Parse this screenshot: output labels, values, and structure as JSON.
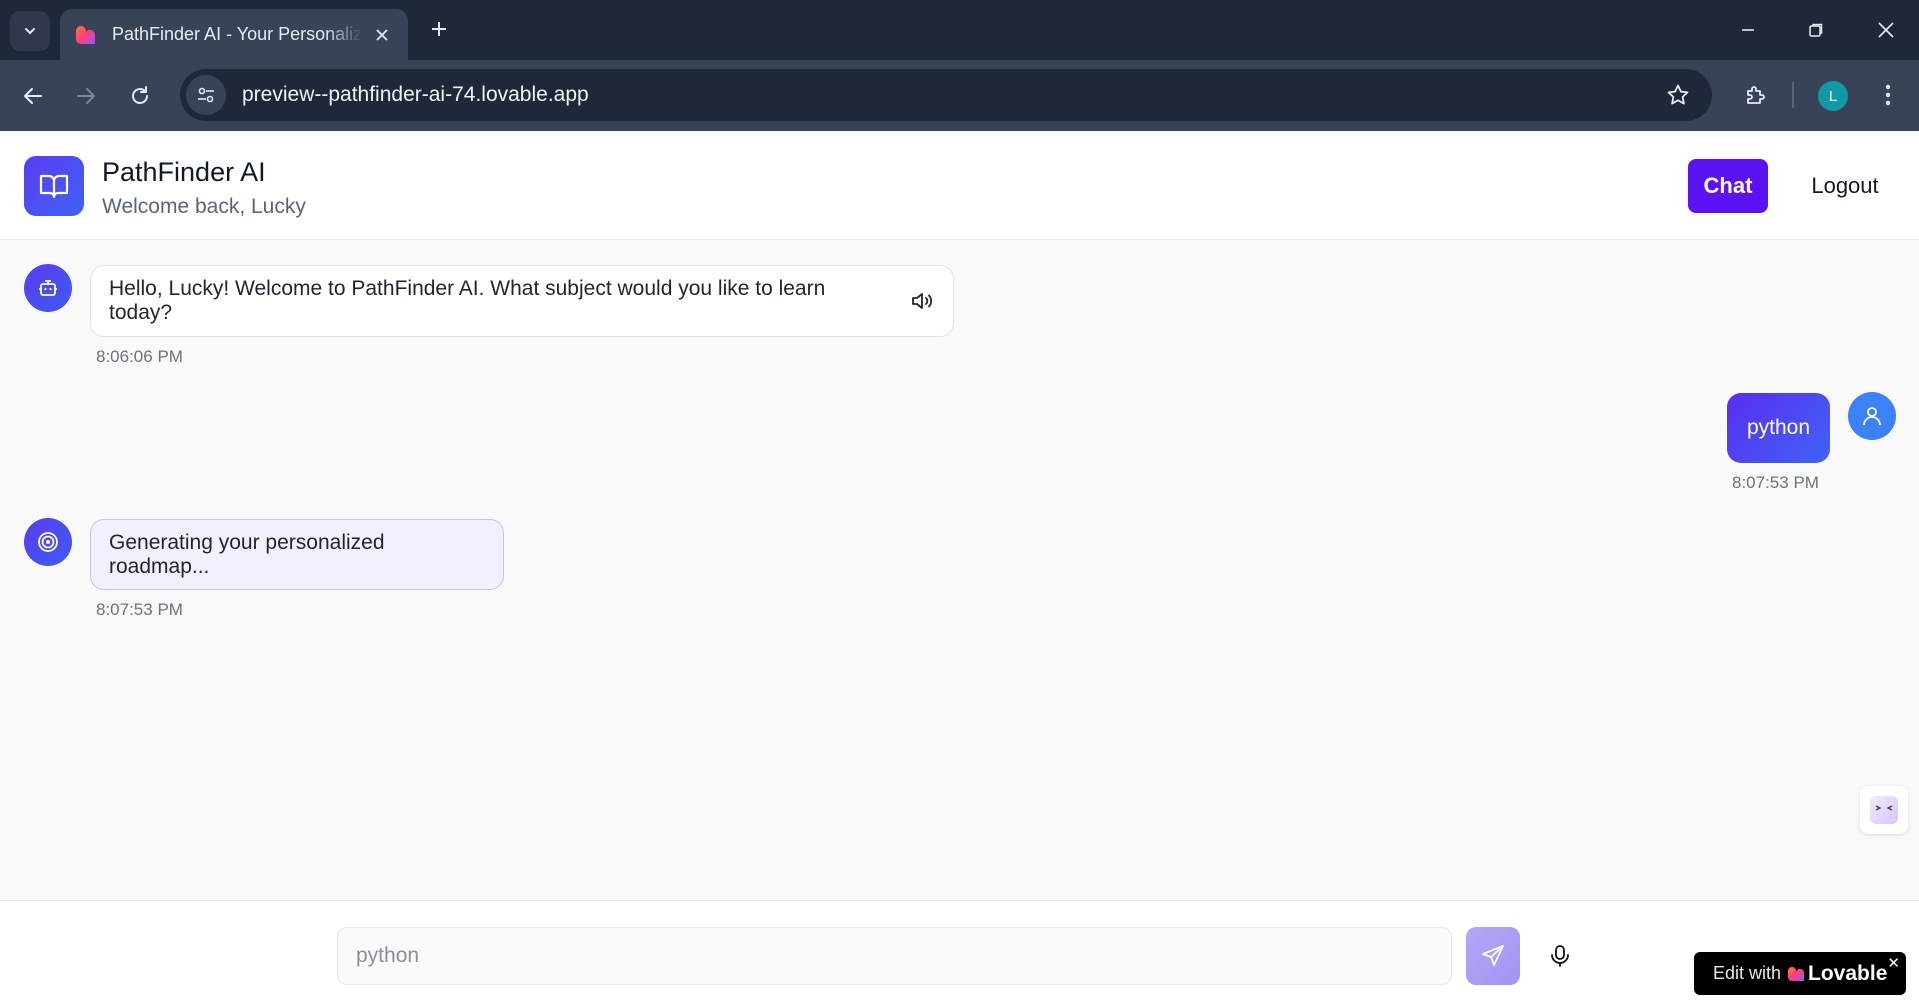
{
  "browser": {
    "tab_title": "PathFinder AI - Your Personalized Learning Path",
    "url": "preview--pathfinder-ai-74.lovable.app",
    "profile_initial": "L"
  },
  "header": {
    "app_name": "PathFinder AI",
    "welcome": "Welcome back, Lucky",
    "chat_label": "Chat",
    "logout_label": "Logout"
  },
  "messages": [
    {
      "role": "assistant",
      "text": "Hello, Lucky! Welcome to PathFinder AI. What subject would you like to learn today?",
      "time": "8:06:06 PM",
      "icon": "bot-icon",
      "has_speaker": true
    },
    {
      "role": "user",
      "text": "python",
      "time": "8:07:53 PM",
      "icon": "user-icon"
    },
    {
      "role": "assistant",
      "text": "Generating your personalized roadmap...",
      "time": "8:07:53 PM",
      "icon": "target-icon",
      "status": "generating"
    }
  ],
  "composer": {
    "placeholder": "python"
  },
  "lovable_badge": {
    "edit_text": "Edit with",
    "brand": "Lovable",
    "close": "✕"
  },
  "colors": {
    "accent": "#5a12f3",
    "chrome_dark": "#1f2838",
    "chrome_mid": "#384358",
    "user_avatar": "#3b82f6"
  }
}
